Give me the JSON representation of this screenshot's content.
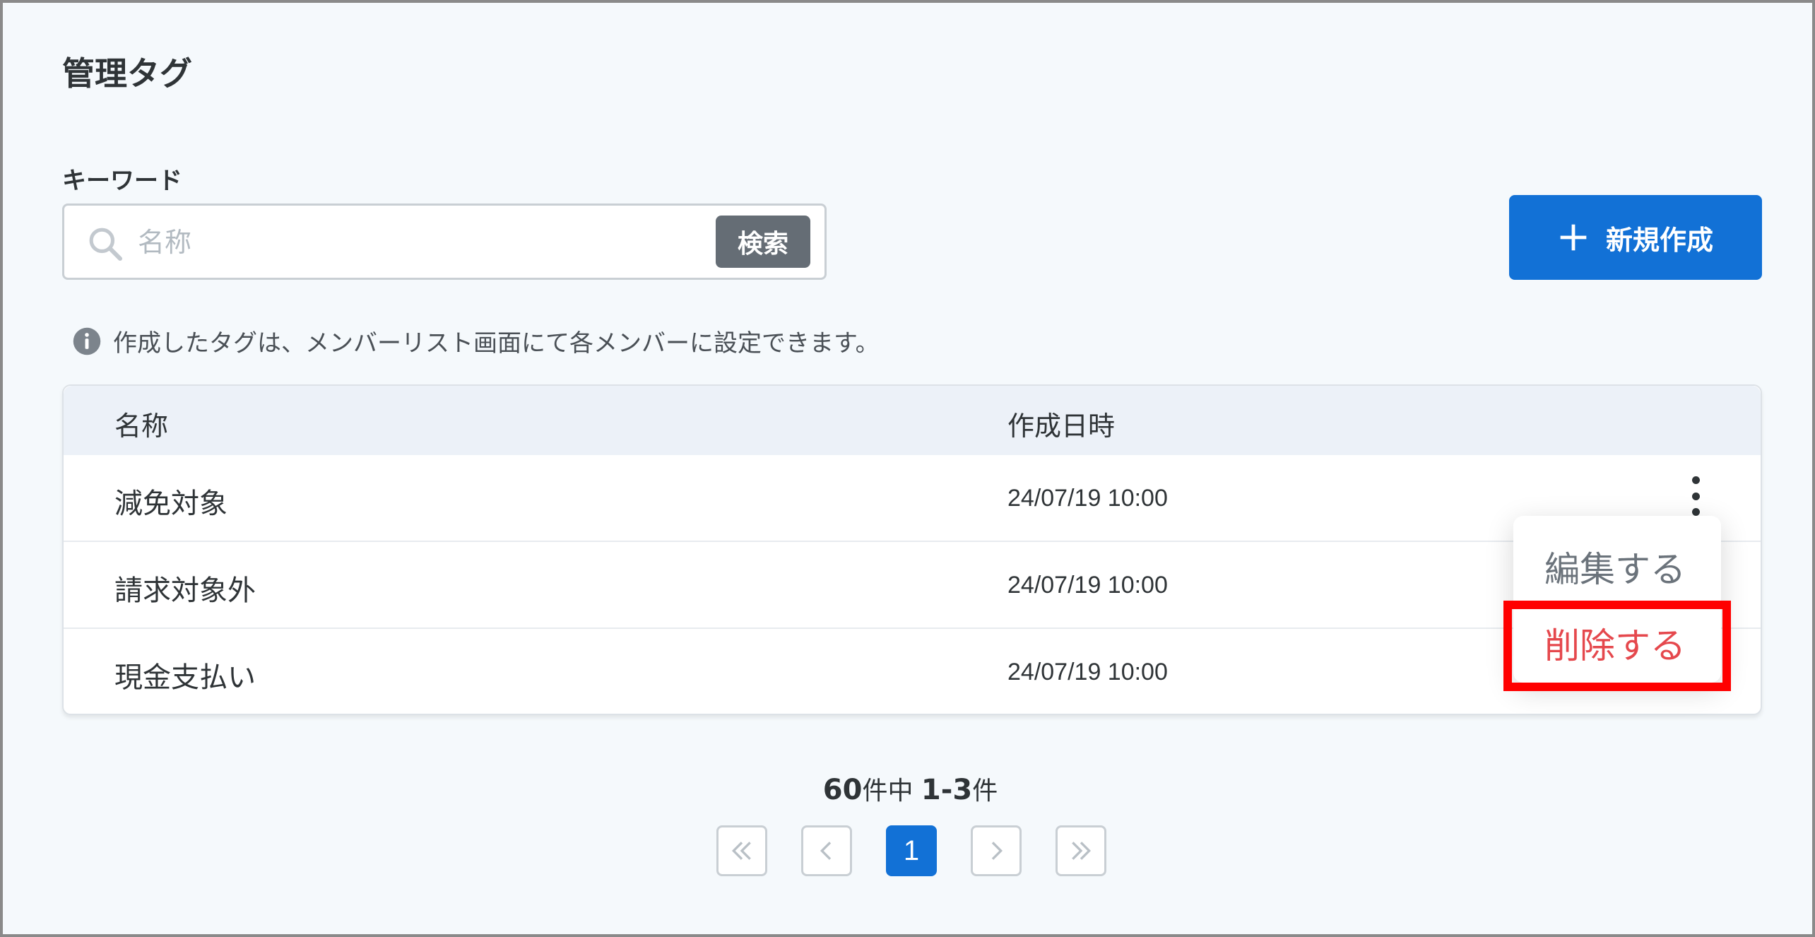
{
  "page": {
    "title": "管理タグ"
  },
  "search": {
    "label": "キーワード",
    "placeholder": "名称",
    "button_label": "検索"
  },
  "toolbar": {
    "new_label": "新規作成"
  },
  "info": {
    "text": "作成したタグは、メンバーリスト画面にて各メンバーに設定できます。"
  },
  "table": {
    "headers": {
      "name": "名称",
      "created": "作成日時"
    },
    "rows": [
      {
        "name": "減免対象",
        "created": "24/07/19 10:00"
      },
      {
        "name": "請求対象外",
        "created": "24/07/19 10:00"
      },
      {
        "name": "現金支払い",
        "created": "24/07/19 10:00"
      }
    ]
  },
  "row_menu": {
    "edit_label": "編集する",
    "delete_label": "削除する"
  },
  "pagination": {
    "total": "60",
    "total_suffix": "件中",
    "range": "1-3",
    "range_suffix": "件",
    "current_page": "1"
  },
  "colors": {
    "primary": "#1271d6",
    "danger": "#e5484d",
    "highlight": "#ff0000",
    "header_bg": "#ecf1f8"
  }
}
